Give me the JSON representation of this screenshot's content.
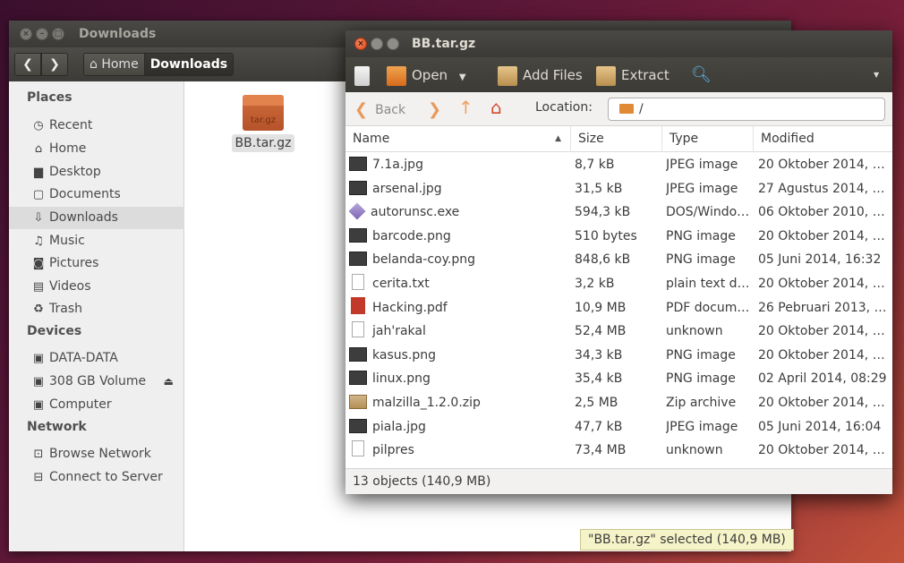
{
  "nautilus": {
    "title": "Downloads",
    "back_label": "❮",
    "forward_label": "❯",
    "path": [
      "Home",
      "Downloads"
    ],
    "sidebar": {
      "places_header": "Places",
      "places": [
        {
          "label": "Recent",
          "icon": "clock-icon"
        },
        {
          "label": "Home",
          "icon": "home-icon"
        },
        {
          "label": "Desktop",
          "icon": "desktop-icon"
        },
        {
          "label": "Documents",
          "icon": "documents-icon"
        },
        {
          "label": "Downloads",
          "icon": "download-icon"
        },
        {
          "label": "Music",
          "icon": "music-icon"
        },
        {
          "label": "Pictures",
          "icon": "camera-icon"
        },
        {
          "label": "Videos",
          "icon": "film-icon"
        },
        {
          "label": "Trash",
          "icon": "trash-icon"
        }
      ],
      "devices_header": "Devices",
      "devices": [
        {
          "label": "DATA-DATA",
          "icon": "drive-icon"
        },
        {
          "label": "308 GB Volume",
          "icon": "drive-icon"
        },
        {
          "label": "Computer",
          "icon": "drive-icon"
        }
      ],
      "network_header": "Network",
      "network": [
        {
          "label": "Browse Network",
          "icon": "network-icon"
        },
        {
          "label": "Connect to Server",
          "icon": "server-icon"
        }
      ]
    },
    "file_icon_label": "tar.gz",
    "file_name": "BB.tar.gz",
    "status": "\"BB.tar.gz\" selected  (140,9 MB)"
  },
  "archive": {
    "title": "BB.tar.gz",
    "toolbar": {
      "open_label": "Open",
      "add_files_label": "Add Files",
      "extract_label": "Extract"
    },
    "location_bar": {
      "back_label": "Back",
      "location_label": "Location:",
      "location_value": "/"
    },
    "columns": {
      "name": "Name",
      "size": "Size",
      "type": "Type",
      "modified": "Modified"
    },
    "files": [
      {
        "name": "7.1a.jpg",
        "size": "8,7 kB",
        "type": "JPEG image",
        "modified": "20 Oktober 2014, 2…",
        "icon": "img"
      },
      {
        "name": "arsenal.jpg",
        "size": "31,5 kB",
        "type": "JPEG image",
        "modified": "27 Agustus 2014, 1…",
        "icon": "img"
      },
      {
        "name": "autorunsc.exe",
        "size": "594,3 kB",
        "type": "DOS/Windo…",
        "modified": "06 Oktober 2010, 0…",
        "icon": "exe"
      },
      {
        "name": "barcode.png",
        "size": "510 bytes",
        "type": "PNG image",
        "modified": "20 Oktober 2014, 1…",
        "icon": "img"
      },
      {
        "name": "belanda-coy.png",
        "size": "848,6 kB",
        "type": "PNG image",
        "modified": "05 Juni 2014, 16:32",
        "icon": "img"
      },
      {
        "name": "cerita.txt",
        "size": "3,2 kB",
        "type": "plain text d…",
        "modified": "20 Oktober 2014, 1…",
        "icon": "txt"
      },
      {
        "name": "Hacking.pdf",
        "size": "10,9 MB",
        "type": "PDF docum…",
        "modified": "26 Pebruari 2013, 1…",
        "icon": "pdf"
      },
      {
        "name": "jah'rakal",
        "size": "52,4 MB",
        "type": "unknown",
        "modified": "20 Oktober 2014, 1…",
        "icon": "bin"
      },
      {
        "name": "kasus.png",
        "size": "34,3 kB",
        "type": "PNG image",
        "modified": "20 Oktober 2014, 2…",
        "icon": "img"
      },
      {
        "name": "linux.png",
        "size": "35,4 kB",
        "type": "PNG image",
        "modified": "02 April 2014, 08:29",
        "icon": "img"
      },
      {
        "name": "malzilla_1.2.0.zip",
        "size": "2,5 MB",
        "type": "Zip archive",
        "modified": "20 Oktober 2014, 2…",
        "icon": "zip"
      },
      {
        "name": "piala.jpg",
        "size": "47,7 kB",
        "type": "JPEG image",
        "modified": "05 Juni 2014, 16:04",
        "icon": "img"
      },
      {
        "name": "pilpres",
        "size": "73,4 MB",
        "type": "unknown",
        "modified": "20 Oktober 2014, 1…",
        "icon": "bin"
      }
    ],
    "status": "13 objects (140,9 MB)"
  }
}
